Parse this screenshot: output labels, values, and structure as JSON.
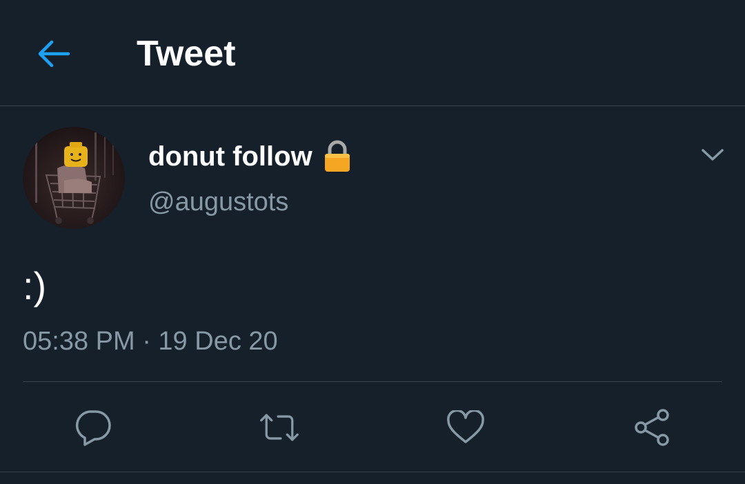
{
  "header": {
    "title": "Tweet",
    "back_icon": "arrow-left-icon"
  },
  "colors": {
    "background": "#15202b",
    "accent": "#1da1f2",
    "secondary_text": "#8899a6",
    "divider": "#38444d"
  },
  "tweet": {
    "author": {
      "display_name": "donut follow",
      "handle": "@augustots",
      "protected_icon": "lock-icon",
      "avatar_icon": "profile-photo"
    },
    "text": ":)",
    "timestamp": "05:38 PM · 19 Dec 20",
    "more_icon": "chevron-down-icon"
  },
  "actions": [
    {
      "name": "reply",
      "icon": "reply-icon"
    },
    {
      "name": "retweet",
      "icon": "retweet-icon"
    },
    {
      "name": "like",
      "icon": "heart-icon"
    },
    {
      "name": "share",
      "icon": "share-icon"
    }
  ]
}
